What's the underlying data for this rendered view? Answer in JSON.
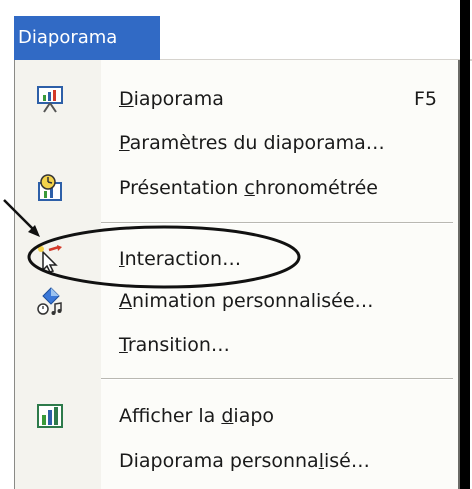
{
  "menubar": {
    "menu_title": "Diaporama"
  },
  "menu": {
    "items": [
      {
        "label_pre": "",
        "label_u": "D",
        "label_post": "iaporama",
        "shortcut": "F5",
        "icon": "slideshow-screen-icon"
      },
      {
        "label_pre": "",
        "label_u": "P",
        "label_post": "aramètres du diaporama…",
        "shortcut": "",
        "icon": ""
      },
      {
        "label_pre": "Présentation ",
        "label_u": "c",
        "label_post": "hronométrée",
        "shortcut": "",
        "icon": "rehearse-timings-clock-icon"
      },
      {
        "label_pre": "",
        "label_u": "I",
        "label_post": "nteraction…",
        "shortcut": "",
        "icon": "action-cursor-icon"
      },
      {
        "label_pre": "",
        "label_u": "A",
        "label_post": "nimation personnalisée…",
        "shortcut": "",
        "icon": "custom-animation-icon"
      },
      {
        "label_pre": "",
        "label_u": "T",
        "label_post": "ransition…",
        "shortcut": "",
        "icon": ""
      },
      {
        "label_pre": "Afficher la ",
        "label_u": "d",
        "label_post": "iapo",
        "shortcut": "",
        "icon": "show-slide-icon"
      },
      {
        "label_pre": "Diaporama personna",
        "label_u": "l",
        "label_post": "isé…",
        "shortcut": "",
        "icon": ""
      }
    ]
  },
  "colors": {
    "highlight": "#316ac5",
    "annotation": "#111111"
  }
}
